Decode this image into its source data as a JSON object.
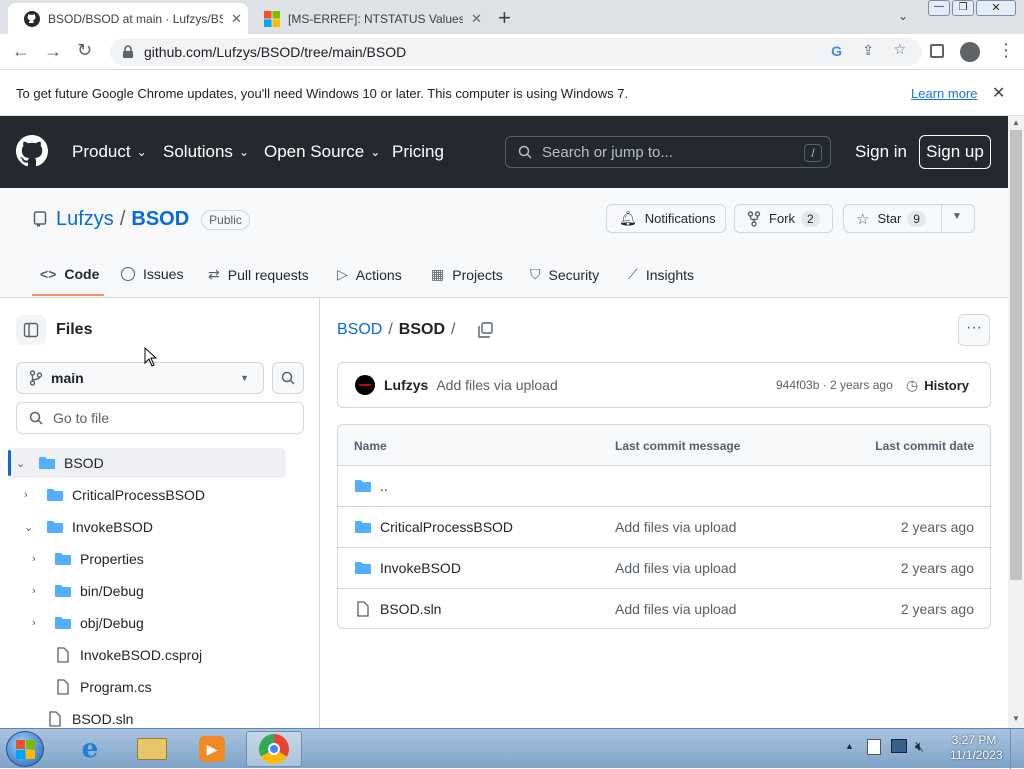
{
  "browser": {
    "tabs": [
      {
        "title": "BSOD/BSOD at main · Lufzys/BSOD",
        "active": true
      },
      {
        "title": "[MS-ERREF]: NTSTATUS Values | Microsoft Learn",
        "active": false
      }
    ],
    "new_tab_symbol": "+",
    "url": "github.com/Lufzys/BSOD/tree/main/BSOD",
    "infobar_text": "To get future Google Chrome updates, you'll need Windows 10 or later. This computer is using Windows 7.",
    "infobar_link": "Learn more"
  },
  "gh_header": {
    "nav": [
      "Product",
      "Solutions",
      "Open Source",
      "Pricing"
    ],
    "search_placeholder": "Search or jump to...",
    "search_key": "/",
    "sign_in": "Sign in",
    "sign_up": "Sign up"
  },
  "repo": {
    "owner": "Lufzys",
    "separator": "/",
    "name": "BSOD",
    "visibility": "Public",
    "notifications_label": "Notifications",
    "fork_label": "Fork",
    "fork_count": "2",
    "star_label": "Star",
    "star_count": "9",
    "tabs": [
      "Code",
      "Issues",
      "Pull requests",
      "Actions",
      "Projects",
      "Security",
      "Insights"
    ]
  },
  "sidebar": {
    "title": "Files",
    "branch": "main",
    "goto_placeholder": "Go to file",
    "tree": [
      {
        "name": "BSOD",
        "type": "folder",
        "expanded": true,
        "selected": true
      },
      {
        "name": "CriticalProcessBSOD",
        "type": "folder",
        "expanded": false
      },
      {
        "name": "InvokeBSOD",
        "type": "folder",
        "expanded": true
      },
      {
        "name": "Properties",
        "type": "folder",
        "expanded": false
      },
      {
        "name": "bin/Debug",
        "type": "folder",
        "expanded": false
      },
      {
        "name": "obj/Debug",
        "type": "folder",
        "expanded": false
      },
      {
        "name": "InvokeBSOD.csproj",
        "type": "file"
      },
      {
        "name": "Program.cs",
        "type": "file"
      },
      {
        "name": "BSOD.sln",
        "type": "file"
      }
    ]
  },
  "main": {
    "breadcrumb": [
      "BSOD",
      "/",
      "BSOD",
      "/"
    ],
    "commit": {
      "author": "Lufzys",
      "message": "Add files via upload",
      "meta": "944f03b · 2 years ago",
      "history_label": "History"
    },
    "table": {
      "headers": [
        "Name",
        "Last commit message",
        "Last commit date"
      ],
      "parent": "..",
      "rows": [
        {
          "name": "CriticalProcessBSOD",
          "type": "folder",
          "message": "Add files via upload",
          "date": "2 years ago"
        },
        {
          "name": "InvokeBSOD",
          "type": "folder",
          "message": "Add files via upload",
          "date": "2 years ago"
        },
        {
          "name": "BSOD.sln",
          "type": "file",
          "message": "Add files via upload",
          "date": "2 years ago"
        }
      ]
    }
  },
  "taskbar": {
    "time": "3:27 PM",
    "date": "11/1/2023"
  },
  "colors": {
    "accent_blue": "#0969da",
    "folder_blue": "#54aeff",
    "gh_dark": "#24292f",
    "tab_underline": "#fd8c73"
  }
}
